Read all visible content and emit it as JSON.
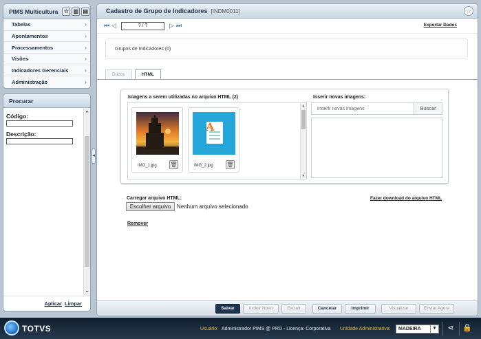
{
  "sidebar": {
    "app_title": "PIMS Multicultura",
    "menu": [
      {
        "label": "Tabelas"
      },
      {
        "label": "Apontamentos"
      },
      {
        "label": "Processamentos"
      },
      {
        "label": "Visões"
      },
      {
        "label": "Indicadores Gerenciais"
      },
      {
        "label": "Administração"
      }
    ],
    "search": {
      "title": "Procurar",
      "code_label": "Código:",
      "code_value": "",
      "desc_label": "Descrição:",
      "desc_value": "",
      "apply": "Aplicar",
      "clear": "Limpar"
    }
  },
  "main": {
    "title": "Cadastro de Grupo de Indicadores",
    "code": "[INDM0011]",
    "record_counter": "? / ?",
    "export_label": "Exportar Dados",
    "group_box": "Grupos de Indicadores (0)",
    "tabs": [
      {
        "label": "Dados",
        "active": false
      },
      {
        "label": "HTML",
        "active": true
      }
    ],
    "images": {
      "title": "Imagens a serem utilizadas no arquivo HTML (2)",
      "items": [
        {
          "name": "IMG_1.jpg",
          "icon": "tower-photo"
        },
        {
          "name": "IMG_2.jpg",
          "icon": "document-a-icon"
        }
      ]
    },
    "insert": {
      "title": "Inserir novas imagens:",
      "placeholder": "Inserir novas imagens",
      "search_button": "Buscar"
    },
    "upload": {
      "label": "Carregar arquivo HTML:",
      "choose_button": "Escolher arquivo",
      "no_file": "Nenhum arquivo selecionado",
      "download_link": "Fazer download do arquivo HTML",
      "remove_link": "Remover"
    },
    "footer_buttons": {
      "save": "Salvar",
      "new": "Incluir Novo",
      "delete": "Excluir",
      "cancel": "Cancelar",
      "print": "Imprimir",
      "view": "Visualizar",
      "send": "Enviar Agora"
    }
  },
  "status": {
    "brand": "TOTVS",
    "user_label": "Usuário:",
    "user_value": "Administrador PIMS @ PRD - Licença: Corporativa",
    "unit_label": "Unidade Administrativa:",
    "unit_value": "MADEIRA"
  }
}
